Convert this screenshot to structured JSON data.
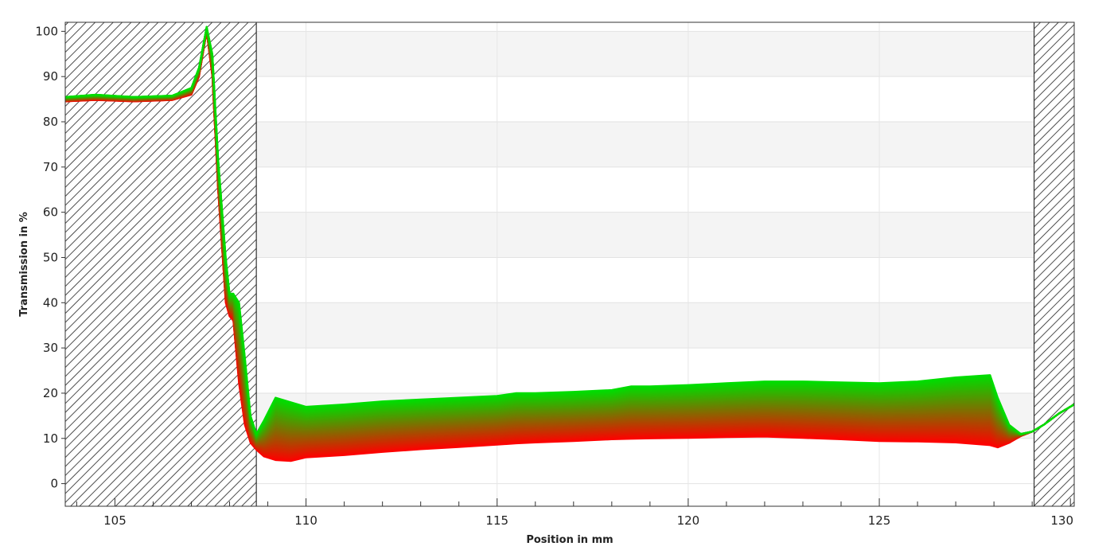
{
  "chart_data": {
    "type": "line",
    "title": "",
    "xlabel": "Position in mm",
    "ylabel": "Transmission in %",
    "xlim": [
      103.7,
      130.1
    ],
    "ylim": [
      -5,
      102
    ],
    "x_ticks": [
      105,
      110,
      115,
      120,
      125,
      130
    ],
    "y_ticks": [
      0,
      10,
      20,
      30,
      40,
      50,
      60,
      70,
      80,
      90,
      100
    ],
    "grid": true,
    "excluded_regions": [
      [
        103.7,
        108.7
      ],
      [
        129.05,
        130.1
      ]
    ],
    "color_gradient": [
      "#00dd00",
      "#ff0000"
    ],
    "series_count": 60,
    "series_envelope": {
      "x": [
        103.7,
        104.5,
        105.5,
        106.5,
        107.0,
        107.2,
        107.4,
        107.55,
        107.7,
        107.9,
        108.0,
        108.1,
        108.25,
        108.4,
        108.55,
        108.7,
        108.9,
        109.2,
        109.6,
        110.0,
        111.0,
        112.0,
        113.0,
        114.0,
        115.0,
        115.5,
        116.0,
        117.0,
        118.0,
        118.5,
        119.0,
        120.0,
        121.0,
        122.0,
        123.0,
        124.0,
        125.0,
        126.0,
        127.0,
        127.9,
        128.1,
        128.4,
        128.7,
        129.0,
        129.3,
        129.7,
        130.1
      ],
      "upper": [
        85.5,
        86.0,
        85.5,
        85.8,
        87.5,
        92.0,
        101.0,
        95.0,
        72.0,
        50.0,
        42.0,
        42.0,
        40.0,
        28.0,
        15.0,
        11.0,
        14.0,
        19.0,
        18.0,
        17.0,
        17.5,
        18.2,
        18.6,
        19.0,
        19.4,
        20.0,
        20.0,
        20.3,
        20.7,
        21.5,
        21.5,
        21.8,
        22.2,
        22.6,
        22.6,
        22.4,
        22.2,
        22.6,
        23.5,
        24.0,
        19.0,
        13.0,
        11.0,
        11.5,
        13.0,
        15.5,
        17.5
      ],
      "lower": [
        84.5,
        84.8,
        84.5,
        84.8,
        86.0,
        90.0,
        100.0,
        90.0,
        65.0,
        40.0,
        37.0,
        36.0,
        22.0,
        13.0,
        9.0,
        7.5,
        6.0,
        5.2,
        5.0,
        5.8,
        6.3,
        7.0,
        7.6,
        8.1,
        8.6,
        8.9,
        9.1,
        9.4,
        9.8,
        9.9,
        10.0,
        10.1,
        10.3,
        10.4,
        10.1,
        9.8,
        9.4,
        9.3,
        9.1,
        8.5,
        8.0,
        9.0,
        10.5,
        11.5,
        13.0,
        15.5,
        17.5
      ]
    }
  }
}
